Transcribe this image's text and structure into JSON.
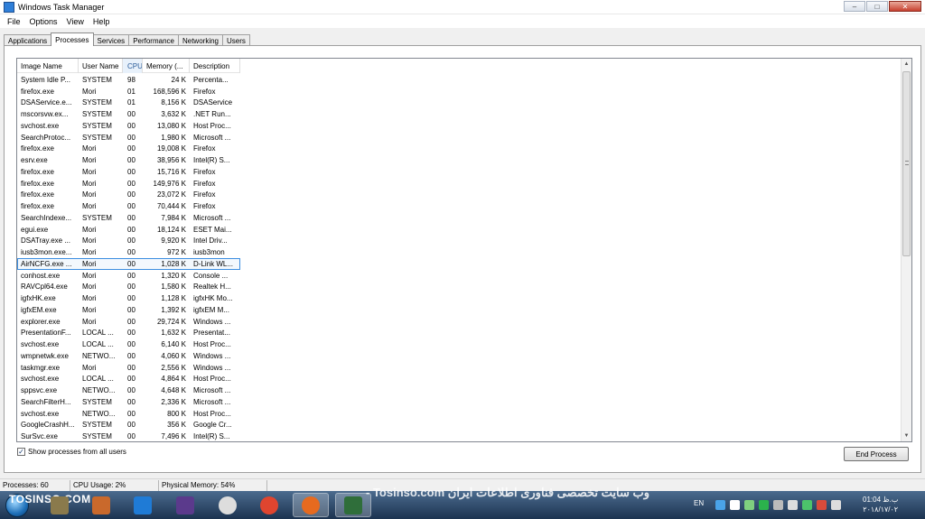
{
  "window": {
    "title": "Windows Task Manager",
    "controls": {
      "minimize": "–",
      "maximize": "□",
      "close": "✕"
    }
  },
  "menu": [
    "File",
    "Options",
    "View",
    "Help"
  ],
  "tabs": [
    {
      "label": "Applications",
      "active": false
    },
    {
      "label": "Processes",
      "active": true
    },
    {
      "label": "Services",
      "active": false
    },
    {
      "label": "Performance",
      "active": false
    },
    {
      "label": "Networking",
      "active": false
    },
    {
      "label": "Users",
      "active": false
    }
  ],
  "table": {
    "columns": [
      "Image Name",
      "User Name",
      "CPU",
      "Memory (...",
      "Description"
    ],
    "sorted_column": "CPU",
    "sort_indicator": "ˆ",
    "selected_row_index": 16,
    "rows": [
      [
        "System Idle P...",
        "SYSTEM",
        "98",
        "24 K",
        "Percenta..."
      ],
      [
        "firefox.exe",
        "Mori",
        "01",
        "168,596 K",
        "Firefox"
      ],
      [
        "DSAService.e...",
        "SYSTEM",
        "01",
        "8,156 K",
        "DSAService"
      ],
      [
        "mscorsvw.ex...",
        "SYSTEM",
        "00",
        "3,632 K",
        ".NET Run..."
      ],
      [
        "svchost.exe",
        "SYSTEM",
        "00",
        "13,080 K",
        "Host Proc..."
      ],
      [
        "SearchProtoc...",
        "SYSTEM",
        "00",
        "1,980 K",
        "Microsoft ..."
      ],
      [
        "firefox.exe",
        "Mori",
        "00",
        "19,008 K",
        "Firefox"
      ],
      [
        "esrv.exe",
        "Mori",
        "00",
        "38,956 K",
        "Intel(R) S..."
      ],
      [
        "firefox.exe",
        "Mori",
        "00",
        "15,716 K",
        "Firefox"
      ],
      [
        "firefox.exe",
        "Mori",
        "00",
        "149,976 K",
        "Firefox"
      ],
      [
        "firefox.exe",
        "Mori",
        "00",
        "23,072 K",
        "Firefox"
      ],
      [
        "firefox.exe",
        "Mori",
        "00",
        "70,444 K",
        "Firefox"
      ],
      [
        "SearchIndexe...",
        "SYSTEM",
        "00",
        "7,984 K",
        "Microsoft ..."
      ],
      [
        "egui.exe",
        "Mori",
        "00",
        "18,124 K",
        "ESET Mai..."
      ],
      [
        "DSATray.exe ...",
        "Mori",
        "00",
        "9,920 K",
        "Intel Driv..."
      ],
      [
        "iusb3mon.exe...",
        "Mori",
        "00",
        "972 K",
        "iusb3mon"
      ],
      [
        "AirNCFG.exe ...",
        "Mori",
        "00",
        "1,028 K",
        "D-Link WL..."
      ],
      [
        "conhost.exe",
        "Mori",
        "00",
        "1,320 K",
        "Console ..."
      ],
      [
        "RAVCpl64.exe",
        "Mori",
        "00",
        "1,580 K",
        "Realtek H..."
      ],
      [
        "igfxHK.exe",
        "Mori",
        "00",
        "1,128 K",
        "igfxHK Mo..."
      ],
      [
        "igfxEM.exe",
        "Mori",
        "00",
        "1,392 K",
        "igfxEM M..."
      ],
      [
        "explorer.exe",
        "Mori",
        "00",
        "29,724 K",
        "Windows ..."
      ],
      [
        "PresentationF...",
        "LOCAL ...",
        "00",
        "1,632 K",
        "Presentat..."
      ],
      [
        "svchost.exe",
        "LOCAL ...",
        "00",
        "6,140 K",
        "Host Proc..."
      ],
      [
        "wmpnetwk.exe",
        "NETWO...",
        "00",
        "4,060 K",
        "Windows ..."
      ],
      [
        "taskmgr.exe",
        "Mori",
        "00",
        "2,556 K",
        "Windows ..."
      ],
      [
        "svchost.exe",
        "LOCAL ...",
        "00",
        "4,864 K",
        "Host Proc..."
      ],
      [
        "sppsvc.exe",
        "NETWO...",
        "00",
        "4,648 K",
        "Microsoft ..."
      ],
      [
        "SearchFilterH...",
        "SYSTEM",
        "00",
        "2,336 K",
        "Microsoft ..."
      ],
      [
        "svchost.exe",
        "NETWO...",
        "00",
        "800 K",
        "Host Proc..."
      ],
      [
        "GoogleCrashH...",
        "SYSTEM",
        "00",
        "356 K",
        "Google Cr..."
      ],
      [
        "SurSvc.exe",
        "SYSTEM",
        "00",
        "7,496 K",
        "Intel(R) S..."
      ]
    ]
  },
  "show_all": {
    "label": "Show processes from all users",
    "checked": true,
    "mark": "✓"
  },
  "end_process_label": "End Process",
  "status": {
    "processes": "Processes: 60",
    "cpu": "CPU Usage: 2%",
    "memory": "Physical Memory: 54%"
  },
  "taskbar": {
    "watermark_left": "TOSINSO.COM",
    "watermark_center": "- Tosinso.com وب سایت تخصصی فناوری اطلاعات ایران",
    "language": "EN",
    "clock_time": "01:04 ب.ظ",
    "clock_date": "۲۰۱۸/۱۷/۰۲",
    "app_colors": [
      "#8a7a4c",
      "#c9692c",
      "#1f7bd6",
      "#5b3a8c",
      "#dddddd",
      "#e0452f",
      "#e66a1f",
      "#2f6e3a"
    ],
    "tray_colors": [
      "#4aa3e8",
      "#ffffff",
      "#7fd07f",
      "#2bb24c",
      "#bbbbbb",
      "#dddddd",
      "#4cc36b",
      "#d94b3b",
      "#dddddd"
    ]
  }
}
